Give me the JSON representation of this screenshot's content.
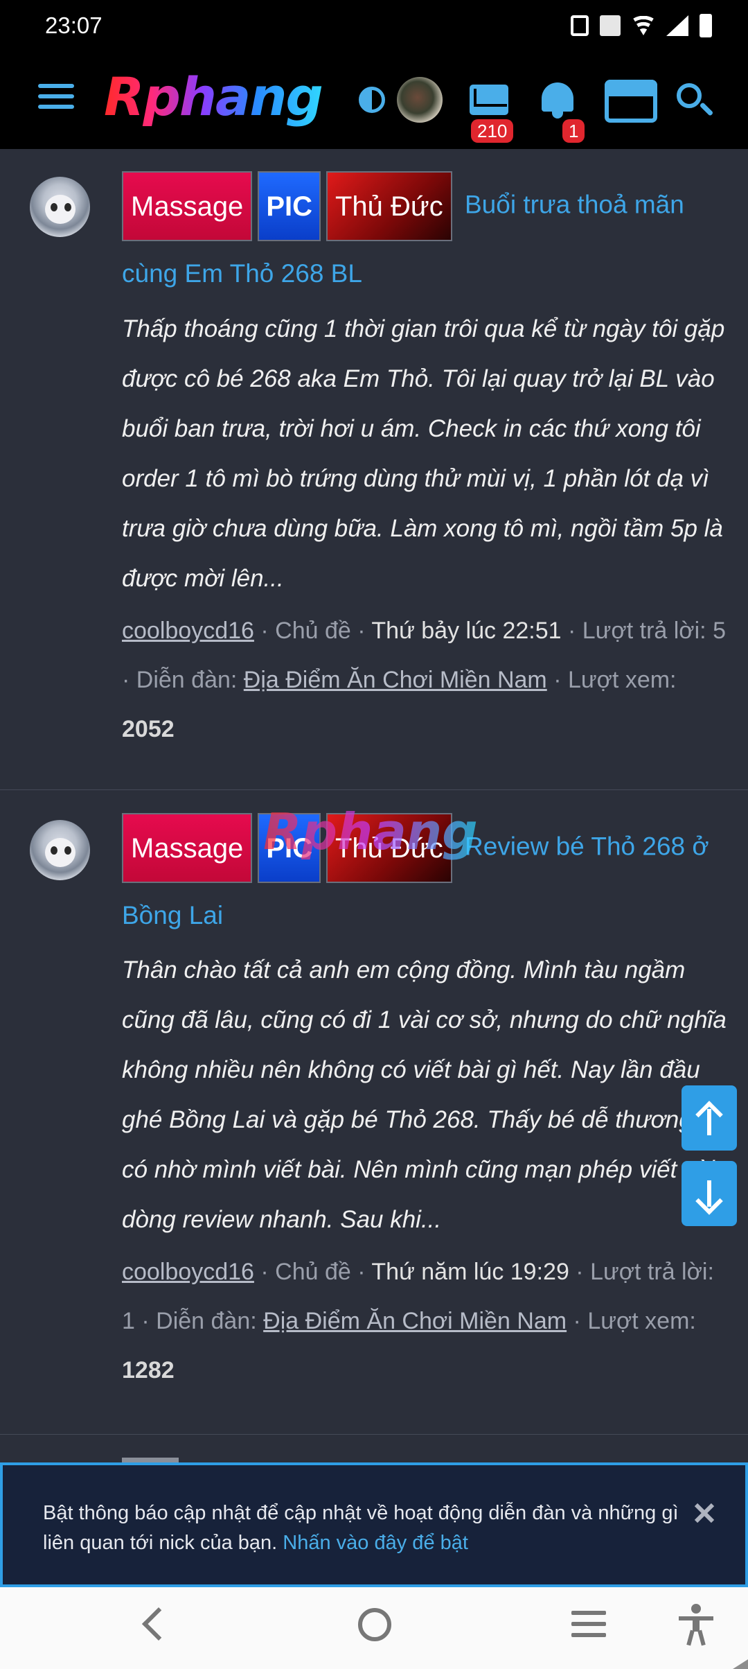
{
  "status_bar": {
    "time": "23:07",
    "icons": [
      "vibrate-icon",
      "volte-icon",
      "wifi-icon",
      "signal-icon",
      "battery-icon"
    ]
  },
  "header": {
    "logo_text": "Rphang",
    "mail_badge": "210",
    "bell_badge": "1",
    "accent_color": "#4aaee9",
    "badge_color": "#e0262e"
  },
  "threads": [
    {
      "tags": [
        "Massage",
        "PIC",
        "Thủ Đức"
      ],
      "title": "Buổi trưa thoả mãn cùng Em Thỏ 268 BL",
      "snippet": "Thấp thoáng cũng 1 thời gian trôi qua kể từ ngày tôi gặp được cô bé 268 aka Em Thỏ. Tôi lại quay trở lại BL vào buổi ban trưa, trời hơi u ám. Check in các thứ xong tôi order 1 tô mì bò trứng dùng thử mùi vị, 1 phần lót dạ vì trưa giờ chưa dùng bữa. Làm xong tô mì, ngồi tầm 5p là được mời lên...",
      "author": "coolboycd16",
      "type_label": "Chủ đề",
      "date": "Thứ bảy lúc 22:51",
      "replies_label": "Lượt trả lời:",
      "replies": "5",
      "forum_label": "Diễn đàn:",
      "forum": "Địa Điểm Ăn Chơi Miền Nam",
      "views_label": "Lượt xem:",
      "views": "2052"
    },
    {
      "tags": [
        "Massage",
        "PIC",
        "Thủ Đức"
      ],
      "title": "Review bé Thỏ 268 ở Bồng Lai",
      "snippet": "Thân chào tất cả anh em cộng đồng. Mình tàu ngầm cũng đã lâu, cũng có đi 1 vài cơ sở, nhưng do chữ nghĩa không nhiều nên không có viết bài gì hết. Nay lần đầu ghé Bồng Lai và gặp bé Thỏ 268. Thấy bé dễ thương và có nhờ mình viết bài. Nên mình cũng mạn phép viết vài dòng review nhanh. Sau khi...",
      "author": "coolboycd16",
      "type_label": "Chủ đề",
      "date": "Thứ năm lúc 19:29",
      "replies_label": "Lượt trả lời:",
      "replies": "1",
      "forum_label": "Diễn đàn:",
      "forum": "Địa Điểm Ăn Chơi Miền Nam",
      "views_label": "Lượt xem:",
      "views": "1282"
    }
  ],
  "watermark": "Rphang",
  "notification": {
    "text": "Bật thông báo cập nhật để cập nhật về hoạt động diễn đàn và những gì liên quan tới nick của bạn.",
    "cta": "Nhấn vào đây để bật"
  },
  "system_nav": [
    "back-icon",
    "home-icon",
    "recents-icon",
    "accessibility-icon"
  ]
}
